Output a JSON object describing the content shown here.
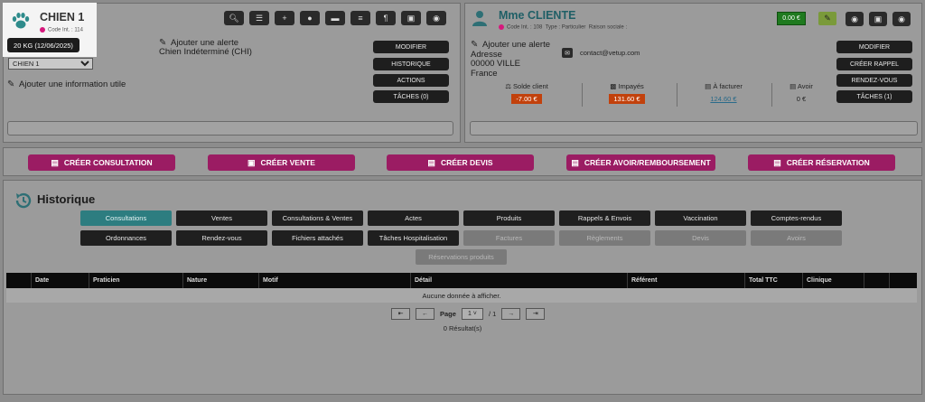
{
  "pet": {
    "name": "CHIEN 1",
    "code": "Code Int. : 114",
    "weight": "20 KG (12/06/2025)",
    "select_value": "CHIEN 1",
    "alert_label": "Ajouter une alerte",
    "species": "Chien Indéterminé (CHI)",
    "info_label": "Ajouter une information utile",
    "buttons": [
      "MODIFIER",
      "HISTORIQUE",
      "ACTIONS",
      "TÂCHES (0)"
    ]
  },
  "client": {
    "name": "Mme CLIENTE",
    "code": "Code Int. : 108",
    "type": "Type : Particulier",
    "raison": "Raison sociale :",
    "balance": "0.00 €",
    "alert_label": "Ajouter une alerte",
    "address_label": "Adresse",
    "city": "00000 VILLE",
    "country": "France",
    "email": "contact@vetup.com",
    "buttons": [
      "MODIFIER",
      "CRÉER RAPPEL",
      "RENDEZ-VOUS",
      "TÂCHES (1)"
    ],
    "stats": [
      {
        "label": "Solde client",
        "value": "-7.00 €"
      },
      {
        "label": "Impayés",
        "value": "131.60 €"
      },
      {
        "label": "À facturer",
        "value": "124.60 €"
      },
      {
        "label": "Avoir",
        "value": "0 €"
      }
    ]
  },
  "create_buttons": [
    "CRÉER CONSULTATION",
    "CRÉER VENTE",
    "CRÉER DEVIS",
    "CRÉER AVOIR/REMBOURSEMENT",
    "CRÉER RÉSERVATION"
  ],
  "history": {
    "title": "Historique",
    "tabs_row1": [
      "Consultations",
      "Ventes",
      "Consultations & Ventes",
      "Actes",
      "Produits",
      "Rappels & Envois",
      "Vaccination",
      "Comptes-rendus"
    ],
    "tabs_row2": [
      "Ordonnances",
      "Rendez-vous",
      "Fichiers attachés",
      "Tâches Hospitalisation",
      "Factures",
      "Règlements",
      "Devis",
      "Avoirs"
    ],
    "tab_row3": "Réservations produits",
    "columns": [
      "",
      "Date",
      "Praticien",
      "Nature",
      "Motif",
      "Détail",
      "Référent",
      "Total TTC",
      "Clinique",
      "",
      ""
    ],
    "empty_text": "Aucune donnée à afficher.",
    "page_label": "Page",
    "page_value": "1",
    "page_total": "/ 1",
    "results": "0 Résultat(s)"
  }
}
